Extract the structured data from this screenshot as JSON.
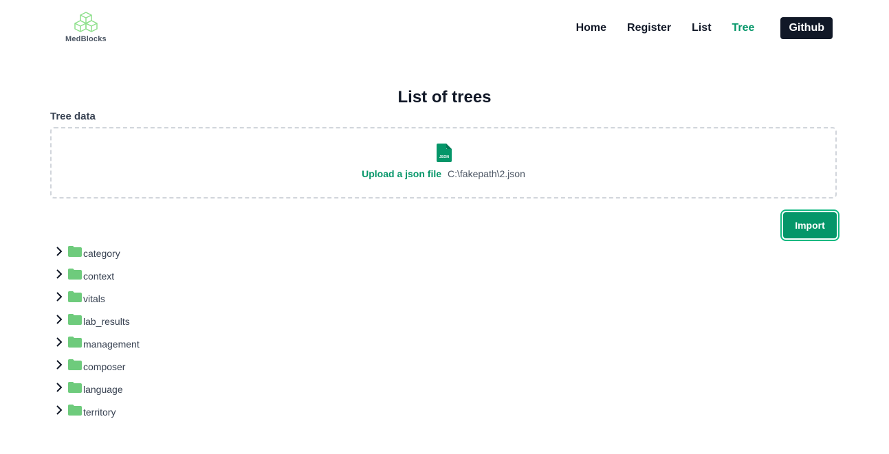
{
  "header": {
    "logo_text": "MedBlocks",
    "nav": [
      {
        "label": "Home"
      },
      {
        "label": "Register"
      },
      {
        "label": "List"
      },
      {
        "label": "Tree",
        "active": true
      }
    ],
    "github_label": "Github"
  },
  "main": {
    "title": "List of trees",
    "field_label": "Tree data",
    "upload": {
      "icon": "json-file-icon",
      "link_label": "Upload a json file",
      "filename": "C:\\fakepath\\2.json"
    },
    "import_label": "Import",
    "tree_items": [
      {
        "label": "category"
      },
      {
        "label": "context"
      },
      {
        "label": "vitals"
      },
      {
        "label": "lab_results"
      },
      {
        "label": "management"
      },
      {
        "label": "composer"
      },
      {
        "label": "language"
      },
      {
        "label": "territory"
      }
    ]
  },
  "colors": {
    "accent": "#059669",
    "folder": "#6ecb7c",
    "dark": "#111827"
  }
}
